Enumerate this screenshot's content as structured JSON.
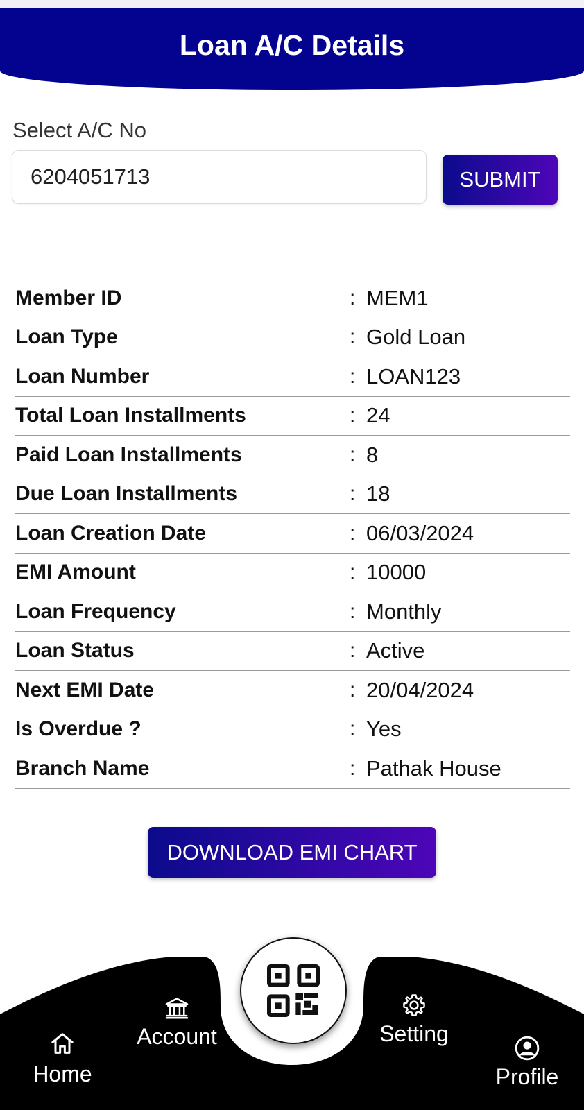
{
  "header": {
    "title": "Loan A/C Details"
  },
  "form": {
    "select_label": "Select A/C No",
    "account_number": "6204051713",
    "submit_label": "SUBMIT"
  },
  "details": [
    {
      "label": "Member ID",
      "value": "MEM1"
    },
    {
      "label": "Loan Type",
      "value": "Gold Loan"
    },
    {
      "label": "Loan Number",
      "value": "LOAN123"
    },
    {
      "label": "Total Loan Installments",
      "value": "24"
    },
    {
      "label": "Paid Loan Installments",
      "value": "8"
    },
    {
      "label": "Due Loan Installments",
      "value": "18"
    },
    {
      "label": "Loan Creation Date",
      "value": "06/03/2024"
    },
    {
      "label": "EMI Amount",
      "value": "10000"
    },
    {
      "label": "Loan Frequency",
      "value": "Monthly"
    },
    {
      "label": "Loan Status",
      "value": "Active"
    },
    {
      "label": "Next EMI Date",
      "value": "20/04/2024"
    },
    {
      "label": "Is Overdue ?",
      "value": "Yes"
    },
    {
      "label": "Branch Name",
      "value": "Pathak House"
    }
  ],
  "separator": ":",
  "download_label": "DOWNLOAD EMI CHART",
  "nav": {
    "home": {
      "label": "Home",
      "icon": "home-icon"
    },
    "account": {
      "label": "Account",
      "icon": "bank-icon"
    },
    "scan": {
      "icon": "qr-code-icon"
    },
    "setting": {
      "label": "Setting",
      "icon": "gear-icon"
    },
    "profile": {
      "label": "Profile",
      "icon": "user-circle-icon"
    }
  },
  "colors": {
    "header": "#03038f",
    "button_start": "#0b0b8c",
    "button_end": "#4d06b8",
    "navbar": "#000000"
  }
}
